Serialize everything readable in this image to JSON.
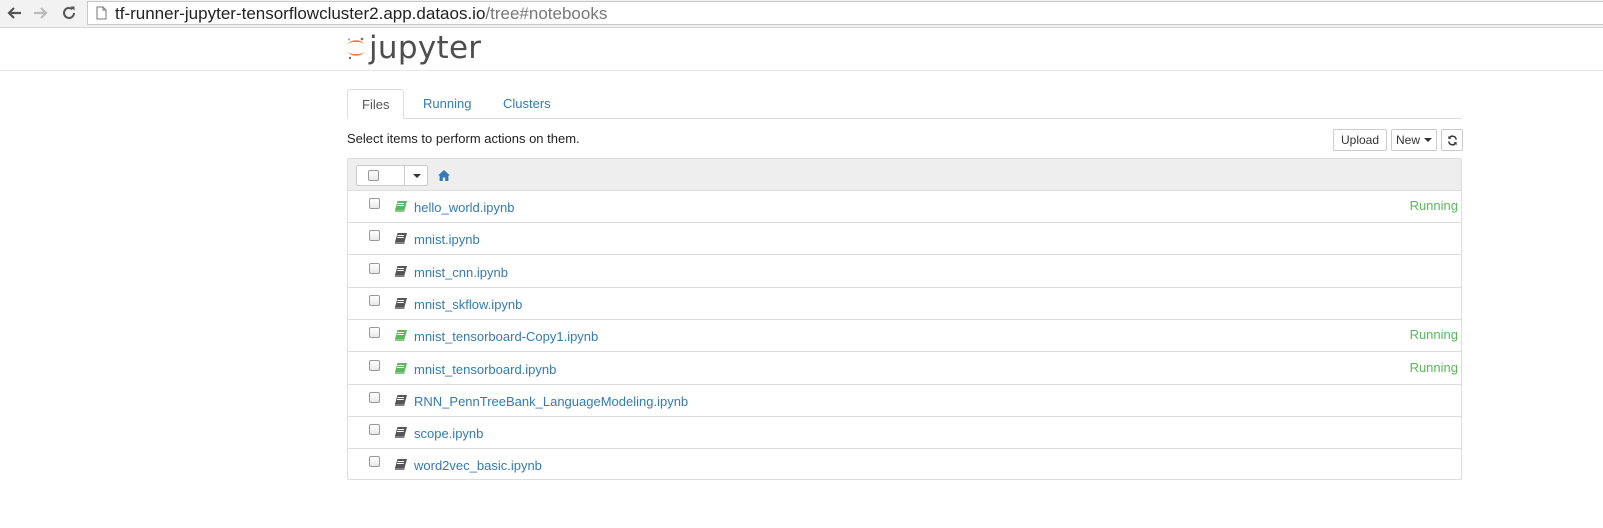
{
  "browser": {
    "url_host": "tf-runner-jupyter-tensorflowcluster2.app.dataos.io",
    "url_path": "/tree#notebooks"
  },
  "header": {
    "logo_text": "jupyter"
  },
  "tabs": [
    {
      "label": "Files",
      "active": true
    },
    {
      "label": "Running",
      "active": false
    },
    {
      "label": "Clusters",
      "active": false
    }
  ],
  "toolbar": {
    "hint": "Select items to perform actions on them.",
    "upload_label": "Upload",
    "new_label": "New"
  },
  "files": [
    {
      "name": "hello_world.ipynb",
      "status": "Running",
      "running": true
    },
    {
      "name": "mnist.ipynb",
      "status": "",
      "running": false
    },
    {
      "name": "mnist_cnn.ipynb",
      "status": "",
      "running": false
    },
    {
      "name": "mnist_skflow.ipynb",
      "status": "",
      "running": false
    },
    {
      "name": "mnist_tensorboard-Copy1.ipynb",
      "status": "Running",
      "running": true
    },
    {
      "name": "mnist_tensorboard.ipynb",
      "status": "Running",
      "running": true
    },
    {
      "name": "RNN_PennTreeBank_LanguageModeling.ipynb",
      "status": "",
      "running": false
    },
    {
      "name": "scope.ipynb",
      "status": "",
      "running": false
    },
    {
      "name": "word2vec_basic.ipynb",
      "status": "",
      "running": false
    }
  ],
  "colors": {
    "link": "#337ab7",
    "running": "#5cb85c",
    "notebook_running_icon": "#5cb85c",
    "notebook_idle_icon": "#555555",
    "logo_orange": "#f37726"
  }
}
